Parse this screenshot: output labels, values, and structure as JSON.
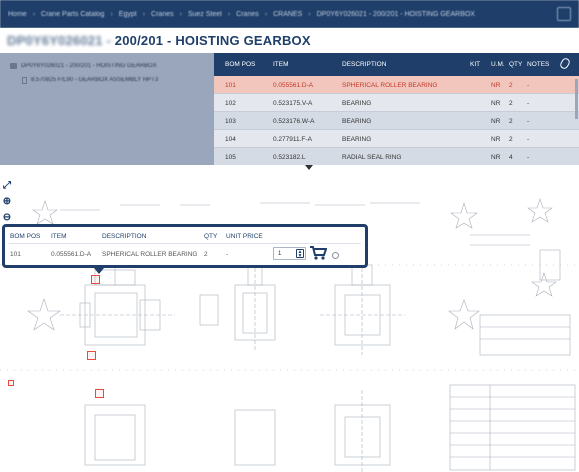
{
  "topbar": {
    "crumbs": [
      "Home",
      "Crane Parts Catalog",
      "Egypt",
      "Cranes",
      "Suez Steel",
      "Cranes",
      "CRANES",
      "DP0Y6Y026021 - 200/201 - HOISTING GEARBOX"
    ],
    "separator": "›"
  },
  "page": {
    "title_id": "DP0Y6Y026021 -",
    "title_main": "200/201 - HOISTING GEARBOX"
  },
  "tree": {
    "nodes": [
      {
        "label": "DP0Y6Y026021 - 200/201 - HOISTING GEARBOX"
      },
      {
        "label": "8.570825 F/L90 - GEARBOX ASSEMBLY HPT3"
      }
    ]
  },
  "parts_table": {
    "columns": {
      "bom_pos": "BOM POS",
      "item": "ITEM",
      "description": "DESCRIPTION",
      "kit": "KIT",
      "um": "U.M.",
      "qty": "QTY",
      "notes": "NOTES"
    },
    "rows": [
      {
        "bom_pos": "101",
        "item": "0.055561.D-A",
        "description": "SPHERICAL ROLLER BEARING",
        "kit": "",
        "um": "NR",
        "qty": "2",
        "notes": "-"
      },
      {
        "bom_pos": "102",
        "item": "0.523175.V-A",
        "description": "BEARING",
        "kit": "",
        "um": "NR",
        "qty": "2",
        "notes": "-"
      },
      {
        "bom_pos": "103",
        "item": "0.523176.W-A",
        "description": "BEARING",
        "kit": "",
        "um": "NR",
        "qty": "2",
        "notes": "-"
      },
      {
        "bom_pos": "104",
        "item": "0.277911.F-A",
        "description": "BEARING",
        "kit": "",
        "um": "NR",
        "qty": "2",
        "notes": "-"
      },
      {
        "bom_pos": "105",
        "item": "0.523182.L",
        "description": "RADIAL SEAL RING",
        "kit": "",
        "um": "NR",
        "qty": "4",
        "notes": "-"
      }
    ]
  },
  "popup": {
    "columns": {
      "bom_pos": "BOM POS",
      "item": "ITEM",
      "description": "DESCRIPTION",
      "qty": "QTY",
      "unit_price": "UNIT PRICE"
    },
    "row": {
      "bom_pos": "101",
      "item": "0.055561.D-A",
      "description": "SPHERICAL ROLLER BEARING",
      "qty": "2",
      "unit_price": "-"
    },
    "quantity_value": "1"
  },
  "icons": {
    "expand": "expand-icon",
    "zoom_in": "zoom-in-icon",
    "zoom_out": "zoom-out-icon",
    "cart": "cart-icon",
    "info": "info-icon",
    "attachment": "paperclip-icon"
  },
  "colors": {
    "brand": "#1f3f6a",
    "selected_row": "#f2c6bd",
    "selected_text": "#c0392b",
    "marker": "#e74c3c"
  }
}
